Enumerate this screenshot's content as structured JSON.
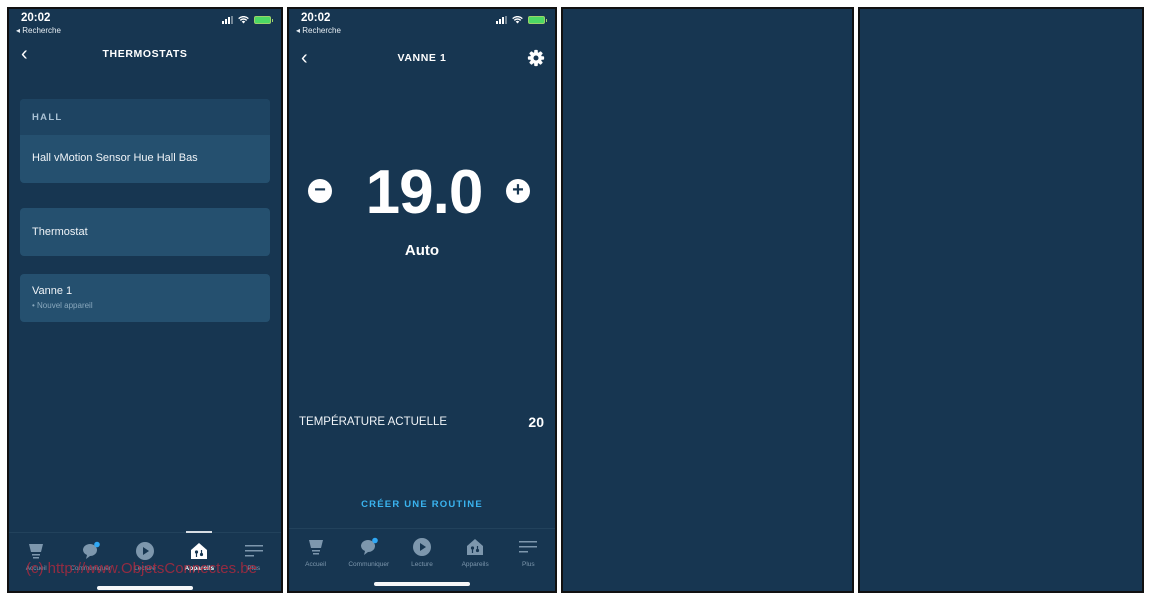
{
  "status_bar": {
    "time": "20:02",
    "back_app": "◂ Recherche"
  },
  "screen1": {
    "title": "THERMOSTATS",
    "groups": [
      {
        "section": "HALL",
        "items": [
          {
            "label": "Hall vMotion Sensor Hue Hall Bas"
          }
        ]
      }
    ],
    "devices": [
      {
        "label": "Thermostat",
        "sub": ""
      },
      {
        "label": "Vanne 1",
        "sub": "• Nouvel appareil"
      }
    ],
    "active_tab": "Appareils"
  },
  "screen2": {
    "title": "VANNE 1",
    "setpoint": "19.0",
    "minus_label": "−",
    "plus_label": "+",
    "mode": "Auto",
    "current_temp_label": "TEMPÉRATURE ACTUELLE",
    "current_temp_value": "20",
    "routine_label": "CRÉER UNE ROUTINE"
  },
  "tabs": [
    {
      "label": "Accueil",
      "icon": "home-display-icon"
    },
    {
      "label": "Communiquer",
      "icon": "chat-bubble-icon"
    },
    {
      "label": "Lecture",
      "icon": "play-icon"
    },
    {
      "label": "Appareils",
      "icon": "devices-house-icon"
    },
    {
      "label": "Plus",
      "icon": "menu-lines-icon"
    }
  ],
  "watermark": "(c) http://www.ObjetsConnectes.be",
  "colors": {
    "background": "#173651",
    "card": "#25506f",
    "accent": "#3ab4f0",
    "badge": "#2fa8f5"
  }
}
